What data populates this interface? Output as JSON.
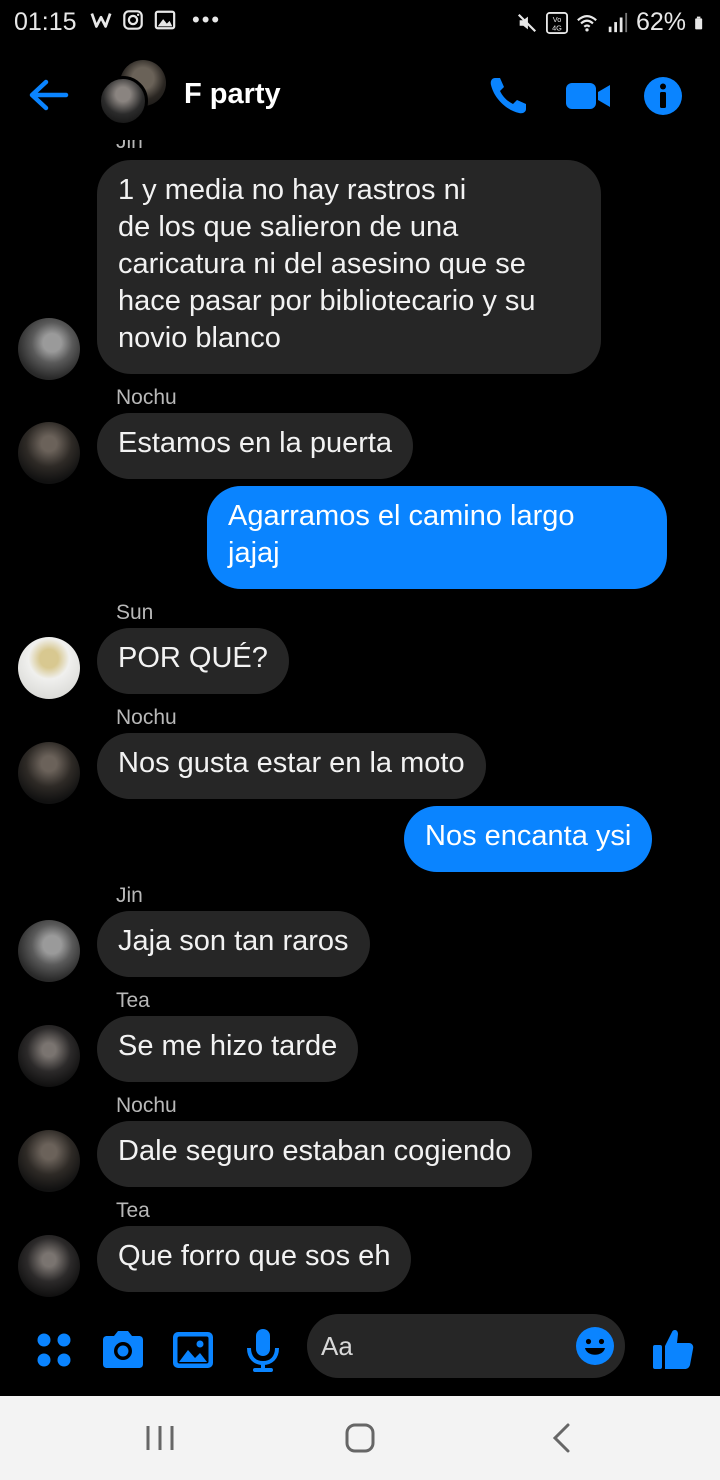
{
  "status_bar": {
    "time": "01:15",
    "battery": "62%",
    "left_icons": [
      "w-icon",
      "instagram-icon",
      "gallery-icon",
      "more-icon"
    ],
    "right_icons": [
      "mute-icon",
      "volte-4g-icon",
      "wifi-icon",
      "signal-icon",
      "battery-icon"
    ]
  },
  "header": {
    "title": "F party",
    "accent_color": "#0a84ff"
  },
  "messages": [
    {
      "cut_sender": "Jin",
      "text": "1 y media no hay rastros ni\nde los que salieron de una\ncaricatura ni del asesino que se\nhace pasar por bibliotecario y su\nnovio blanco",
      "sender": "Jin"
    },
    {
      "sender": "Nochu",
      "text": "Estamos en la puerta"
    },
    {
      "outgoing": true,
      "text": "Agarramos el camino largo\njajaj"
    },
    {
      "sender": "Sun",
      "text": "POR QUÉ?"
    },
    {
      "sender": "Nochu",
      "text": "Nos gusta estar en la moto"
    },
    {
      "outgoing": true,
      "text": "Nos encanta ysi"
    },
    {
      "sender": "Jin",
      "text": "Jaja son tan raros"
    },
    {
      "sender": "Tea",
      "text": "Se me hizo tarde"
    },
    {
      "sender": "Nochu",
      "text": "Dale seguro estaban cogiendo"
    },
    {
      "sender": "Tea",
      "text": "Que forro que sos eh"
    }
  ],
  "composer": {
    "placeholder": "Aa"
  },
  "colors": {
    "outgoing_bubble": "#0a84ff",
    "incoming_bubble": "#262626",
    "background": "#000000"
  }
}
